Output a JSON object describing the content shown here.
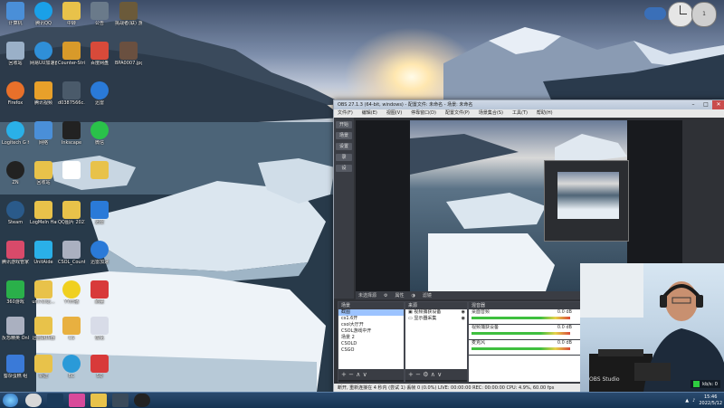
{
  "desktop": {
    "icons": [
      {
        "label": "计算机",
        "color": "#4a8fd8"
      },
      {
        "label": "腾讯QQ",
        "color": "#1aa0e8"
      },
      {
        "label": "中转",
        "color": "#e8c24a"
      },
      {
        "label": "公告",
        "color": "#6a7a8a"
      },
      {
        "label": "挑战者(联)\n游戏",
        "color": "#6b5a3a"
      },
      {
        "label": "回收站",
        "color": "#9ab0c8"
      },
      {
        "label": "网易UU加速器",
        "color": "#2f8fd8"
      },
      {
        "label": "Counter-Strike\nGlobal Off...",
        "color": "#d89a2a"
      },
      {
        "label": "百度网盘",
        "color": "#d84a3a"
      },
      {
        "label": "BPA0007.jpg",
        "color": "#6a5040"
      },
      {
        "label": "Firefox",
        "color": "#e8702a"
      },
      {
        "label": "腾讯视频",
        "color": "#e8a02a"
      },
      {
        "label": "d0387566c...",
        "color": "#4a5a6a"
      },
      {
        "label": "迅雷",
        "color": "#2a7ad8"
      },
      {
        "label": "Logitech\nG HUB",
        "color": "#2ab0e8"
      },
      {
        "label": "网络",
        "color": "#4a8fd8"
      },
      {
        "label": "Inkscape",
        "color": "#222222"
      },
      {
        "label": "微信",
        "color": "#2ac24a"
      },
      {
        "label": "ZN",
        "color": "#222222"
      },
      {
        "label": "回收站",
        "color": "#e8c24a"
      },
      {
        "label": "",
        "color": "#ffffff"
      },
      {
        "label": "",
        "color": "#e8c24a"
      },
      {
        "label": "Steam",
        "color": "#2a5a8a"
      },
      {
        "label": "LogMeIn\nHamachi",
        "color": "#e8c24a"
      },
      {
        "label": "QQ图片\n20211212...",
        "color": "#e8c24a"
      },
      {
        "label": "迅雷",
        "color": "#2a7ad8"
      },
      {
        "label": "腾讯游戏管家\n工具",
        "color": "#d84a6a"
      },
      {
        "label": "UnitAide",
        "color": "#2ab0e8"
      },
      {
        "label": "CSOL_Count...\nOnline",
        "color": "#aab0c0"
      },
      {
        "label": "迅雷加速",
        "color": "#2a7ad8"
      },
      {
        "label": "360游戏",
        "color": "#2ab04a"
      },
      {
        "label": "uni7st记...",
        "color": "#e8c24a"
      },
      {
        "label": "YY开播",
        "color": "#f0d020"
      },
      {
        "label": "刷量",
        "color": "#d83a3a"
      },
      {
        "label": "反恐精英\nOnline",
        "color": "#aab0c0"
      },
      {
        "label": "迅雷跳转器",
        "color": "#e8c24a"
      },
      {
        "label": "CS",
        "color": "#e8b040"
      },
      {
        "label": "优化",
        "color": "#d8dce8"
      },
      {
        "label": "蜀杂蛋糕\n组",
        "color": "#3a7ad8"
      },
      {
        "label": "新建",
        "color": "#e8c24a"
      },
      {
        "label": "BC",
        "color": "#2a9ad8"
      },
      {
        "label": "SQ",
        "color": "#d83a3a"
      }
    ],
    "widget_numbers": [
      "1",
      "0"
    ]
  },
  "obs": {
    "title": "OBS 27.1.3 (64-bit, windows) - 配置文件: 未命名 - 场景: 未命名",
    "menu": [
      "文件(F)",
      "编辑(E)",
      "视图(V)",
      "停靠窗口(D)",
      "配置文件(P)",
      "场景集合(S)",
      "工具(T)",
      "帮助(H)"
    ],
    "side_labels": [
      "开始",
      "场景",
      "设置",
      "录",
      "设"
    ],
    "preview_hdr": "未选择源",
    "preview_tabs": [
      "属性",
      "滤镜"
    ],
    "scenes": {
      "header": "场景",
      "items": [
        "截图",
        "cs1.6开",
        "csol大厅开",
        "CSOL游戏中开",
        "场景 2",
        "CSOLD",
        "CSGO"
      ],
      "selected_index": 0
    },
    "sources": {
      "header": "来源",
      "items": [
        "视频捕获设备",
        "显示器采集"
      ]
    },
    "mixer": {
      "header": "混音器",
      "rows": [
        {
          "name": "桌面音频",
          "value": "0.0 dB"
        },
        {
          "name": "视频捕获设备",
          "value": "0.0 dB"
        },
        {
          "name": "麦克风",
          "value": "0.0 dB"
        }
      ]
    },
    "statusbar": "断开, 重新连接在 4 秒内 (尝试 1)       丢帧 0 (0.0%)   LIVE: 00:00:00   REC: 00:00:00   CPU: 4.9%, 60.00 fps",
    "watermark": "OBS Studio",
    "kbps": "kb/s: 0"
  },
  "taskbar": {
    "time": "15:46",
    "date": "2022/5/12",
    "items": [
      {
        "name": "start-orb",
        "color": "#3a8ad8"
      },
      {
        "name": "chrome",
        "color": "#d8d8d8"
      },
      {
        "name": "steam",
        "color": "#1a3a5a"
      },
      {
        "name": "papers",
        "color": "#d84a9a"
      },
      {
        "name": "explorer",
        "color": "#e8c24a"
      },
      {
        "name": "cs",
        "color": "#3a4a5a"
      },
      {
        "name": "obs",
        "color": "#222222"
      }
    ]
  },
  "colors": {
    "accent": "#3a8ad8",
    "live_green": "#2ecc40",
    "record_red": "#d83a3a"
  }
}
